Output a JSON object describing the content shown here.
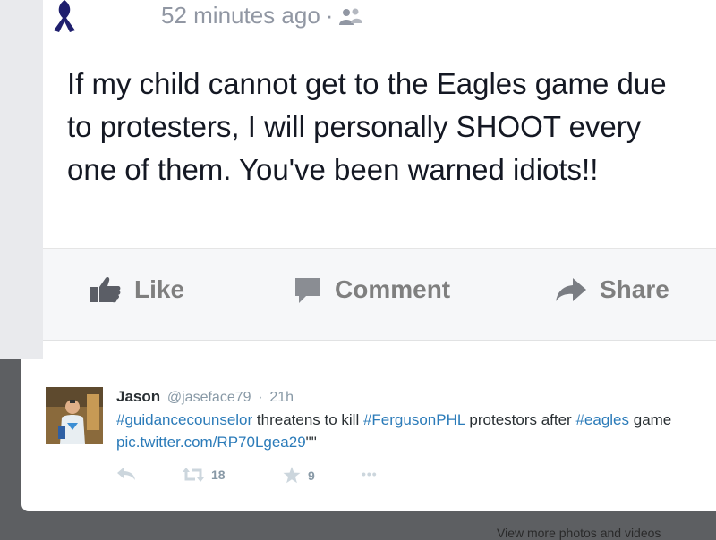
{
  "facebook_post": {
    "timestamp": "52 minutes ago",
    "separator": "·",
    "audience_icon": "friends-icon",
    "body": "If my child cannot get to the Eagles game due to protesters, I will personally SHOOT every one of them. You've been warned idiots!!",
    "actions": {
      "like": "Like",
      "comment": "Comment",
      "share": "Share"
    }
  },
  "tweet": {
    "name": "Jason",
    "handle": "@jaseface79",
    "meta_sep": "·",
    "time": "21h",
    "segments": [
      {
        "text": "#guidancecounselor",
        "link": true
      },
      {
        "text": " threatens to kill ",
        "link": false
      },
      {
        "text": "#FergusonPHL",
        "link": true
      },
      {
        "text": " protestors after ",
        "link": false
      },
      {
        "text": "#eagles",
        "link": true
      },
      {
        "text": " game ",
        "link": false
      },
      {
        "text": "pic.twitter.com/RP70Lgea29",
        "link": true
      },
      {
        "text": "\"\"",
        "link": false
      }
    ],
    "retweets": "18",
    "favorites": "9",
    "more": "•••"
  },
  "footer_partial_text": "View more photos and videos",
  "colors": {
    "link": "#2b7bb9",
    "fb_text": "#141823",
    "fb_muted": "#9197a3",
    "background": "#5d5f62",
    "ribbon": "#1f1f6e"
  }
}
